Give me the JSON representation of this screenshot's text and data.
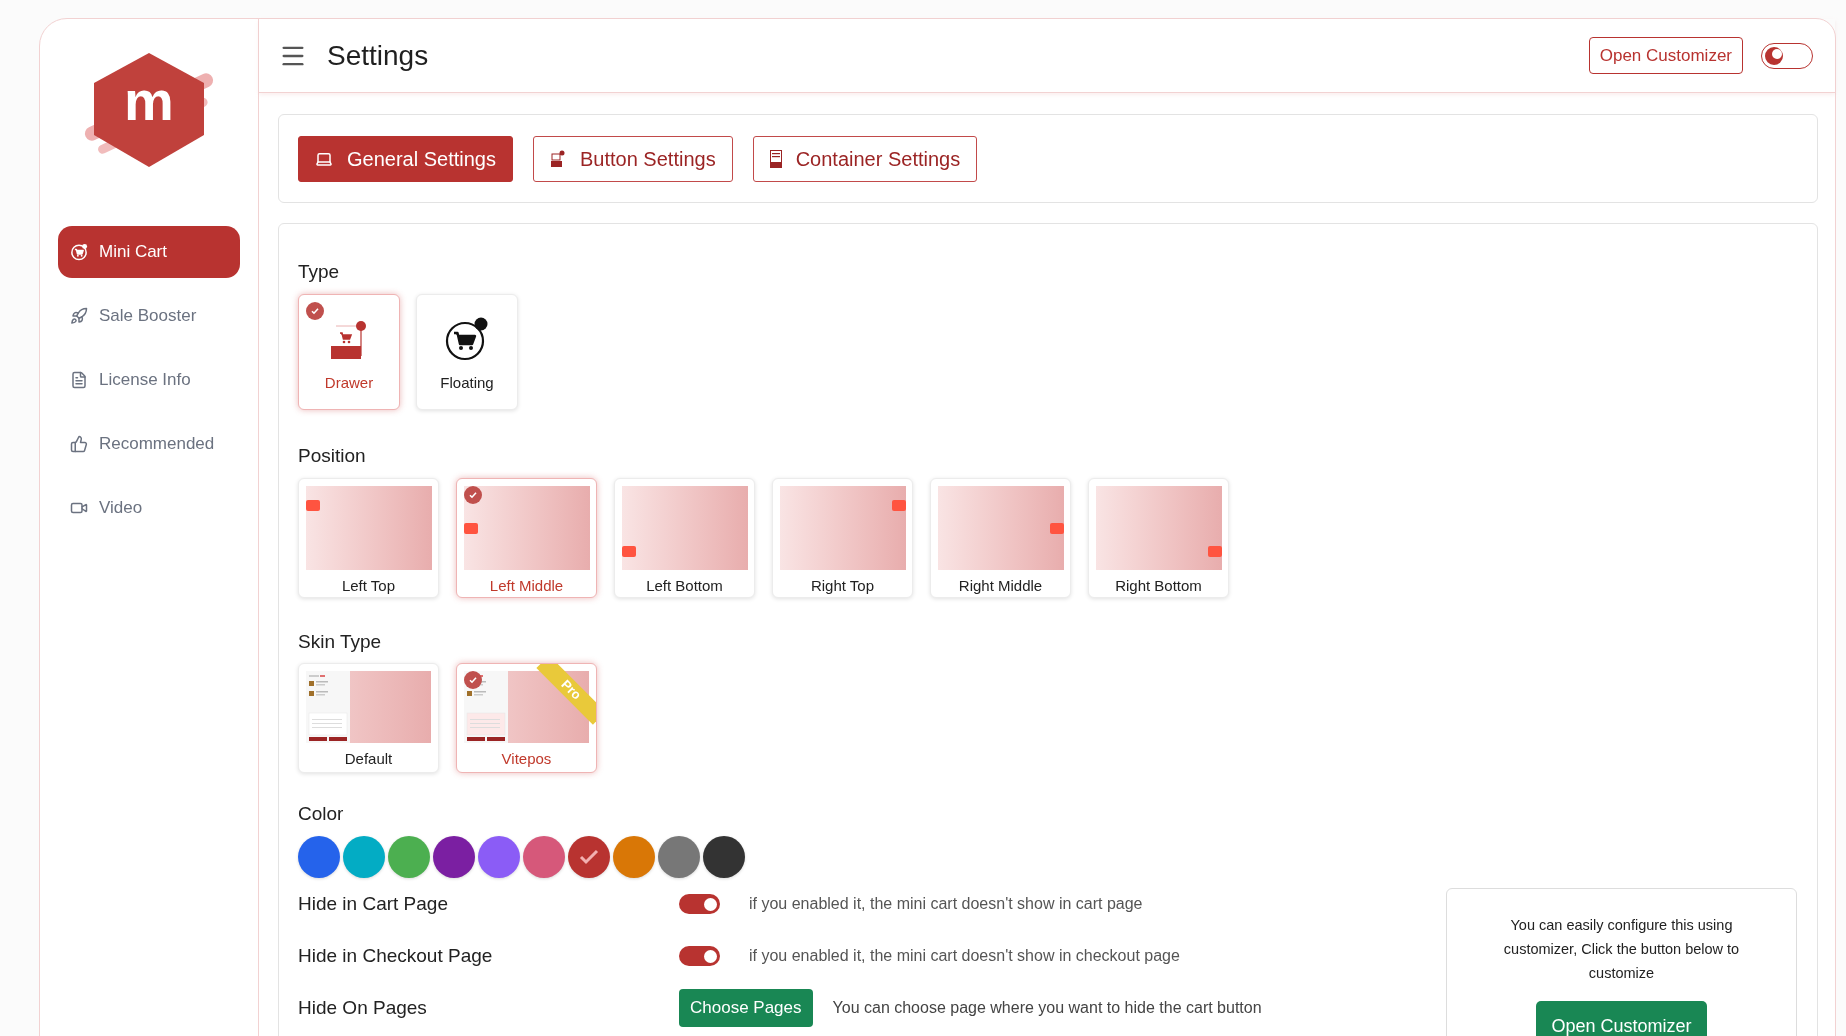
{
  "logo": {
    "letter": "m"
  },
  "sidebar": {
    "items": [
      {
        "label": "Mini Cart",
        "selected": true
      },
      {
        "label": "Sale Booster",
        "selected": false
      },
      {
        "label": "License Info",
        "selected": false
      },
      {
        "label": "Recommended",
        "selected": false
      },
      {
        "label": "Video",
        "selected": false
      }
    ]
  },
  "header": {
    "title": "Settings",
    "customizer_button": "Open Customizer",
    "dark_mode": false
  },
  "tabs": [
    {
      "label": "General Settings",
      "selected": true
    },
    {
      "label": "Button Settings",
      "selected": false
    },
    {
      "label": "Container Settings",
      "selected": false
    }
  ],
  "type": {
    "label": "Type",
    "options": [
      {
        "label": "Drawer",
        "kind": "drawer",
        "selected": true
      },
      {
        "label": "Floating",
        "kind": "floating",
        "selected": false
      }
    ]
  },
  "position": {
    "label": "Position",
    "options": [
      {
        "label": "Left Top",
        "kind": "left-top",
        "selected": false
      },
      {
        "label": "Left Middle",
        "kind": "left-middle",
        "selected": true
      },
      {
        "label": "Left Bottom",
        "kind": "left-bottom",
        "selected": false
      },
      {
        "label": "Right Top",
        "kind": "right-top",
        "selected": false
      },
      {
        "label": "Right Middle",
        "kind": "right-middle",
        "selected": false
      },
      {
        "label": "Right Bottom",
        "kind": "right-bottom",
        "selected": false
      }
    ]
  },
  "skin": {
    "label": "Skin Type",
    "options": [
      {
        "label": "Default",
        "selected": false
      },
      {
        "label": "Vitepos",
        "selected": true,
        "badge": "Pro"
      }
    ]
  },
  "color": {
    "label": "Color",
    "swatches": [
      {
        "color": "#2563eb",
        "selected": false
      },
      {
        "color": "#03acc4",
        "selected": false
      },
      {
        "color": "#4caf50",
        "selected": false
      },
      {
        "color": "#7b1fa2",
        "selected": false
      },
      {
        "color": "#8b5cf6",
        "selected": false
      },
      {
        "color": "#d6587a",
        "selected": false
      },
      {
        "color": "#b83330",
        "selected": true
      },
      {
        "color": "#d97706",
        "selected": false
      },
      {
        "color": "#777777",
        "selected": false
      },
      {
        "color": "#333333",
        "selected": false
      }
    ]
  },
  "settings": [
    {
      "kind": "toggle",
      "label": "Hide in Cart Page",
      "on": true,
      "hint": "if you enabled it, the mini cart doesn't show in cart page"
    },
    {
      "kind": "toggle",
      "label": "Hide in Checkout Page",
      "on": true,
      "hint": "if you enabled it, the mini cart doesn't show in checkout page"
    },
    {
      "kind": "button",
      "label": "Hide On Pages",
      "button": "Choose Pages",
      "hint": "You can choose page where you want to hide the cart button"
    }
  ],
  "info_box": {
    "text": "You can easily configure this using customizer, Click the button below to customize",
    "button": "Open Customizer"
  }
}
